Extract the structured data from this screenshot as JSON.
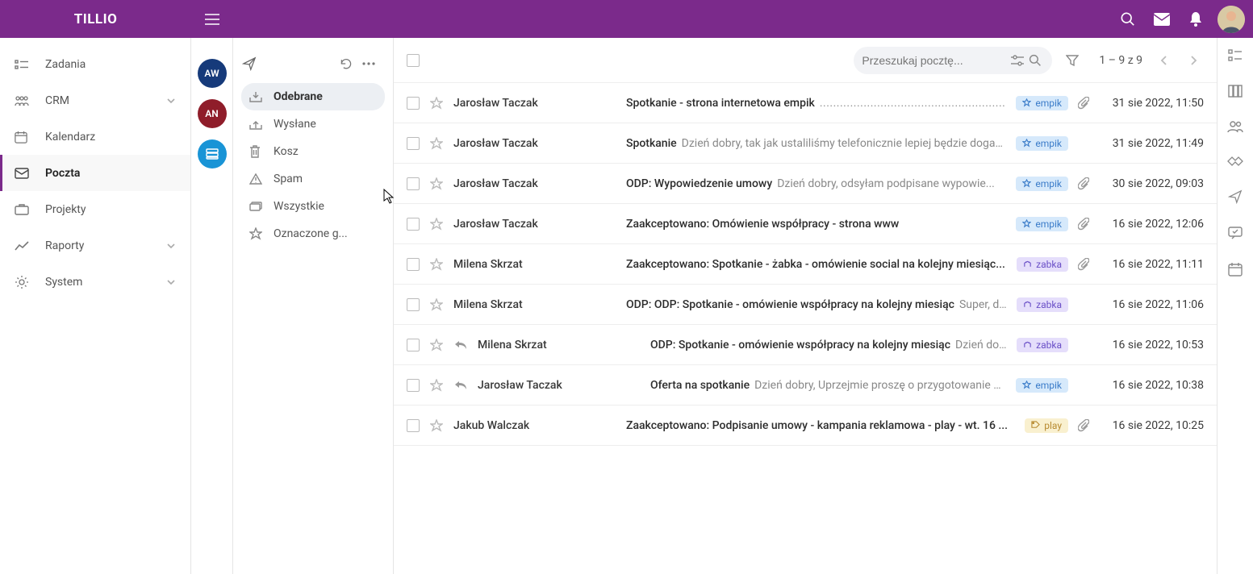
{
  "brand": "TILLIO",
  "sidebar": {
    "items": [
      {
        "label": "Zadania",
        "icon": "tasks",
        "expandable": false
      },
      {
        "label": "CRM",
        "icon": "crm",
        "expandable": true
      },
      {
        "label": "Kalendarz",
        "icon": "calendar",
        "expandable": false
      },
      {
        "label": "Poczta",
        "icon": "mail",
        "expandable": false,
        "selected": true
      },
      {
        "label": "Projekty",
        "icon": "projects",
        "expandable": false
      },
      {
        "label": "Raporty",
        "icon": "reports",
        "expandable": true
      },
      {
        "label": "System",
        "icon": "settings",
        "expandable": true
      }
    ]
  },
  "accounts": [
    {
      "initials": "AW",
      "color": "blue"
    },
    {
      "initials": "AN",
      "color": "red"
    },
    {
      "initials": "",
      "color": "teal",
      "icon": "stack"
    }
  ],
  "folders": [
    {
      "label": "Odebrane",
      "icon": "inbox",
      "selected": true
    },
    {
      "label": "Wysłane",
      "icon": "sent"
    },
    {
      "label": "Kosz",
      "icon": "trash"
    },
    {
      "label": "Spam",
      "icon": "spam"
    },
    {
      "label": "Wszystkie",
      "icon": "all"
    },
    {
      "label": "Oznaczone g...",
      "icon": "star"
    }
  ],
  "search": {
    "placeholder": "Przeszukaj pocztę..."
  },
  "pager": {
    "text": "1 – 9 z 9"
  },
  "emails": [
    {
      "sender": "Jarosław Taczak",
      "subject": "Spotkanie - strona internetowa empik",
      "preview": "",
      "dots": true,
      "tag": {
        "text": "empik",
        "color": "blue"
      },
      "clip": true,
      "date": "31 sie 2022, 11:50"
    },
    {
      "sender": "Jarosław Taczak",
      "subject": "Spotkanie",
      "preview": "Dzień dobry, tak jak ustaliliśmy telefonicznie lepiej będzie dogada...",
      "tag": {
        "text": "empik",
        "color": "blue"
      },
      "date": "31 sie 2022, 11:49"
    },
    {
      "sender": "Jarosław Taczak",
      "subject": "ODP: Wypowiedzenie umowy",
      "preview": "Dzień dobry, odsyłam podpisane wypowie...",
      "tag": {
        "text": "empik",
        "color": "blue"
      },
      "clip": true,
      "date": "30 sie 2022, 09:03"
    },
    {
      "sender": "Jarosław Taczak",
      "subject": "Zaakceptowano: Omówienie współpracy - strona www",
      "preview": "",
      "tag": {
        "text": "empik",
        "color": "blue"
      },
      "clip": true,
      "date": "16 sie 2022, 12:06"
    },
    {
      "sender": "Milena Skrzat",
      "subject": "Zaakceptowano: Spotkanie - żabka - omówienie social na kolejny miesiąc...",
      "preview": "",
      "tag": {
        "text": "zabka",
        "color": "violet"
      },
      "clip": true,
      "date": "16 sie 2022, 11:11"
    },
    {
      "sender": "Milena Skrzat",
      "subject": "ODP: ODP: Spotkanie - omówienie współpracy na kolejny miesiąc",
      "preview": "Super, dzię...",
      "tag": {
        "text": "zabka",
        "color": "violet"
      },
      "date": "16 sie 2022, 11:06"
    },
    {
      "sender": "Milena Skrzat",
      "subject": "ODP: Spotkanie - omówienie współpracy na kolejny miesiąc",
      "preview": "Dzień dobry, ten ...",
      "reply": true,
      "tag": {
        "text": "zabka",
        "color": "violet"
      },
      "date": "16 sie 2022, 10:53"
    },
    {
      "sender": "Jarosław Taczak",
      "subject": "Oferta na spotkanie",
      "preview": "Dzień dobry, Uprzejmie proszę o przygotowanie na spot...",
      "reply": true,
      "tag": {
        "text": "empik",
        "color": "blue"
      },
      "date": "16 sie 2022, 10:38"
    },
    {
      "sender": "Jakub Walczak",
      "subject": "Zaakceptowano: Podpisanie umowy - kampania reklamowa - play - wt. 16 ...",
      "preview": "",
      "tag": {
        "text": "play",
        "color": "yellow"
      },
      "clip": true,
      "date": "16 sie 2022, 10:25"
    }
  ]
}
